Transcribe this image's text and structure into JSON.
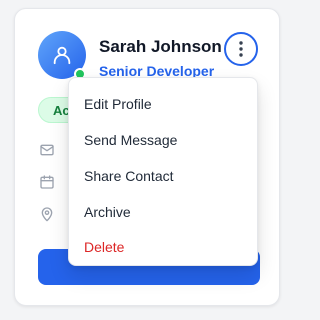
{
  "profile": {
    "name": "Sarah Johnson",
    "role": "Senior Developer",
    "status_badge": "Active",
    "avatar_icon": "user-icon",
    "online_indicator_color": "#22c55e"
  },
  "menu_button": {
    "icon": "more-vertical-icon"
  },
  "info_icons": [
    "mail-icon",
    "calendar-icon",
    "map-pin-icon"
  ],
  "dropdown": {
    "items": [
      {
        "label": "Edit Profile"
      },
      {
        "label": "Send Message"
      },
      {
        "label": "Share Contact"
      },
      {
        "label": "Archive"
      },
      {
        "label": "Delete",
        "danger": true
      }
    ]
  },
  "colors": {
    "accent": "#2563eb",
    "danger": "#dc2626",
    "badge_bg": "#dcfce7",
    "badge_text": "#15803d"
  }
}
